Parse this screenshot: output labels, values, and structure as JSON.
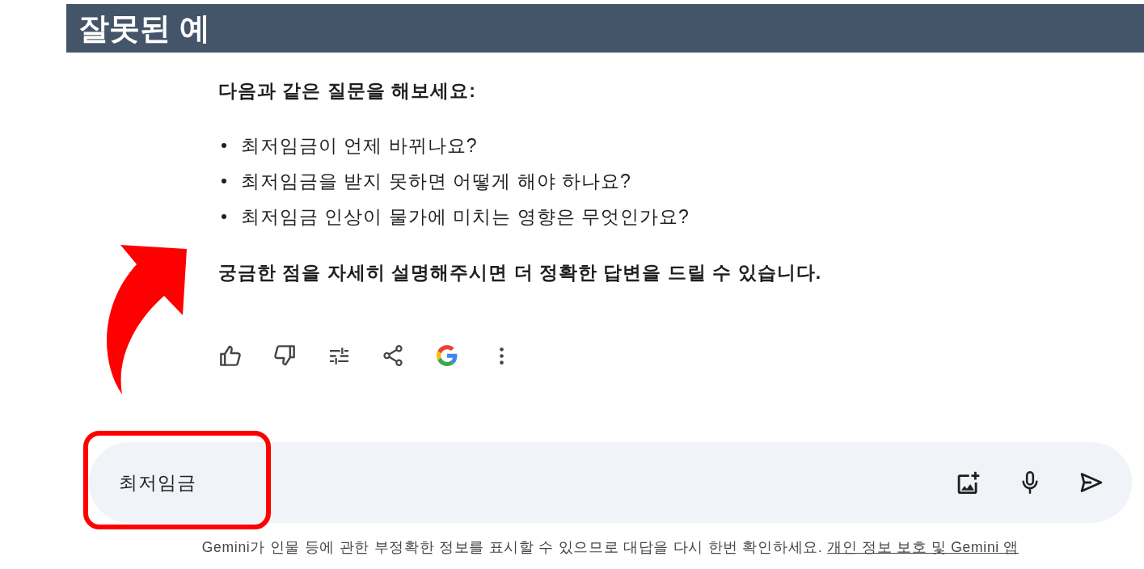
{
  "banner": {
    "title": "잘못된 예"
  },
  "response": {
    "heading": "다음과 같은 질문을 해보세요:",
    "suggestions": [
      "최저임금이 언제 바뀌나요?",
      "최저임금을 받지 못하면 어떻게 해야 하나요?",
      "최저임금 인상이 물가에 미치는 영향은 무엇인가요?"
    ],
    "closing": "궁금한 점을 자세히 설명해주시면 더 정확한 답변을 드릴 수 있습니다."
  },
  "prompt": {
    "value": "최저임금"
  },
  "disclaimer": {
    "text": "Gemini가 인물 등에 관한 부정확한 정보를 표시할 수 있으므로 대답을 다시 한번 확인하세요.",
    "link": "개인 정보 보호 및 Gemini 앱"
  }
}
